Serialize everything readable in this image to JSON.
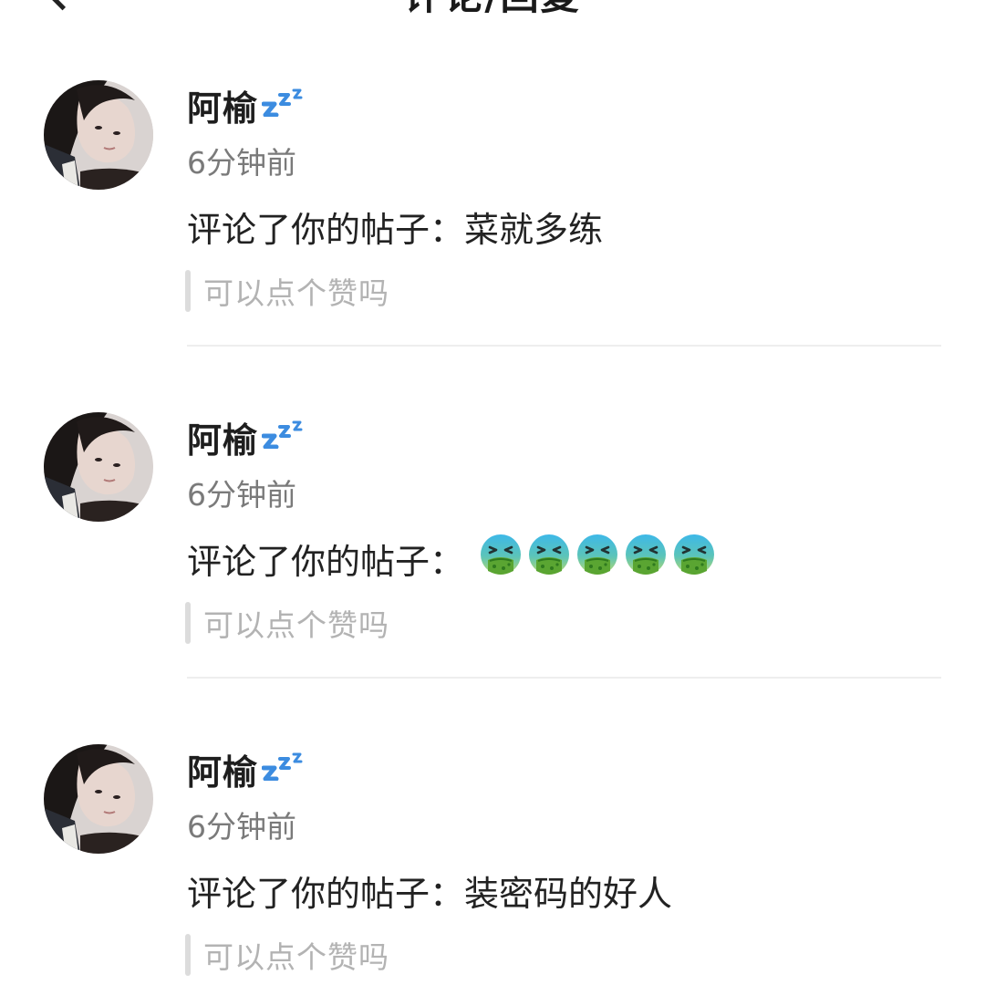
{
  "header": {
    "title": "评论/回复"
  },
  "colors": {
    "background": "#ffffff",
    "name": "#1e1e1e",
    "time": "#7a7a7a",
    "reply_hint": "#b3b3b3",
    "divider": "#eeeeee"
  },
  "notifications": [
    {
      "user_name": "阿榆",
      "name_badge_icon": "zzz-sleeping-icon",
      "time": "6分钟前",
      "comment_prefix": "评论了你的帖子：",
      "comment_text": "菜就多练",
      "comment_emoji": [],
      "reply_placeholder": "可以点个赞吗"
    },
    {
      "user_name": "阿榆",
      "name_badge_icon": "zzz-sleeping-icon",
      "time": "6分钟前",
      "comment_prefix": "评论了你的帖子：",
      "comment_text": "",
      "comment_emoji": [
        "sick-face-icon",
        "sick-face-icon",
        "sick-face-icon",
        "sick-face-icon",
        "sick-face-icon"
      ],
      "reply_placeholder": "可以点个赞吗"
    },
    {
      "user_name": "阿榆",
      "name_badge_icon": "zzz-sleeping-icon",
      "time": "6分钟前",
      "comment_prefix": "评论了你的帖子：",
      "comment_text": "装密码的好人",
      "comment_emoji": [],
      "reply_placeholder": "可以点个赞吗"
    }
  ]
}
